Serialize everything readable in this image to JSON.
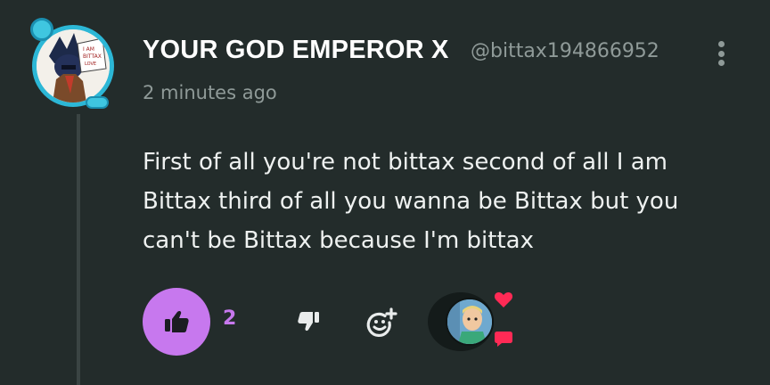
{
  "comment": {
    "username": "YOUR GOD EMPEROR X",
    "handle": "@bittax194866952",
    "timestamp": "2 minutes ago",
    "text": "First of all you're not bittax second of all I am Bittax third of all you wanna be Bittax but you can't be Bittax because I'm bittax"
  },
  "actions": {
    "like_count": "2"
  },
  "icons": {
    "like": "thumbs-up-icon",
    "dislike": "thumbs-down-icon",
    "react": "add-reaction-icon",
    "more": "kebab-menu-icon",
    "heart": "heart-icon",
    "chat": "chat-bubble-icon"
  },
  "colors": {
    "background": "#232c2b",
    "accent": "#c778ee",
    "avatar_frame": "#2cb7d6",
    "badge": "#ff2a55"
  }
}
